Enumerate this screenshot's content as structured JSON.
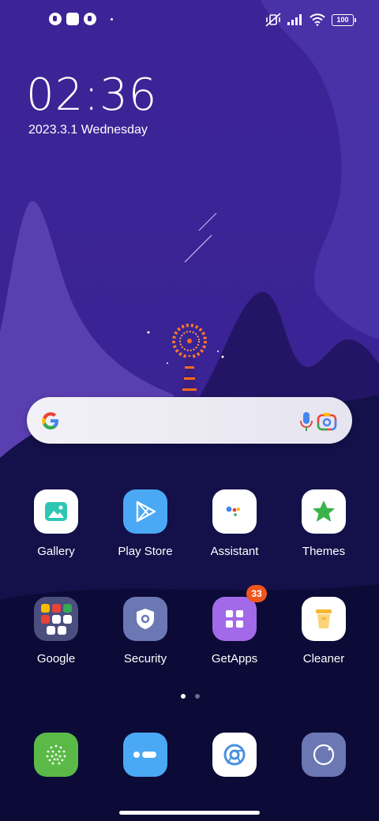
{
  "status_bar": {
    "battery": "100"
  },
  "lock_clock": {
    "time": "02:36",
    "date": "2023.3.1 Wednesday"
  },
  "apps_row1": [
    {
      "label": "Gallery"
    },
    {
      "label": "Play Store"
    },
    {
      "label": "Assistant"
    },
    {
      "label": "Themes"
    }
  ],
  "apps_row2": [
    {
      "label": "Google"
    },
    {
      "label": "Security"
    },
    {
      "label": "GetApps",
      "badge": "33"
    },
    {
      "label": "Cleaner"
    }
  ],
  "dock": [
    {
      "icon": "phone-icon"
    },
    {
      "icon": "messages-icon"
    },
    {
      "icon": "chrome-icon"
    },
    {
      "icon": "camera-icon"
    }
  ],
  "colors": {
    "sky_top": "#3b2596",
    "ground": "#0d0b3c",
    "accent_badge": "#f0551c"
  }
}
